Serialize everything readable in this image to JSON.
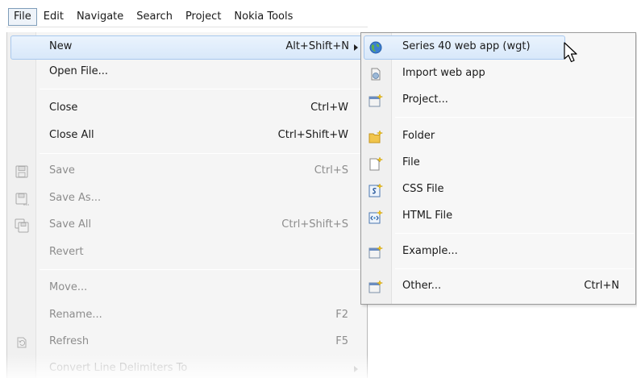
{
  "menubar": {
    "items": [
      "File",
      "Edit",
      "Navigate",
      "Search",
      "Project",
      "Nokia Tools"
    ]
  },
  "file_menu": {
    "new": {
      "label": "New",
      "shortcut": "Alt+Shift+N"
    },
    "open_file": {
      "label": "Open File..."
    },
    "close": {
      "label": "Close",
      "shortcut": "Ctrl+W"
    },
    "close_all": {
      "label": "Close All",
      "shortcut": "Ctrl+Shift+W"
    },
    "save": {
      "label": "Save",
      "shortcut": "Ctrl+S"
    },
    "save_as": {
      "label": "Save As..."
    },
    "save_all": {
      "label": "Save All",
      "shortcut": "Ctrl+Shift+S"
    },
    "revert": {
      "label": "Revert"
    },
    "move": {
      "label": "Move..."
    },
    "rename": {
      "label": "Rename...",
      "shortcut": "F2"
    },
    "refresh": {
      "label": "Refresh",
      "shortcut": "F5"
    },
    "convert": {
      "label": "Convert Line Delimiters To"
    }
  },
  "new_submenu": {
    "series40": {
      "label": "Series 40 web app (wgt)",
      "icon": "globe-icon"
    },
    "import": {
      "label": "Import web app",
      "icon": "import-icon"
    },
    "project": {
      "label": "Project...",
      "icon": "new-project-icon"
    },
    "folder": {
      "label": "Folder",
      "icon": "new-folder-icon"
    },
    "file": {
      "label": "File",
      "icon": "new-file-icon"
    },
    "css": {
      "label": "CSS File",
      "icon": "css-file-icon"
    },
    "html": {
      "label": "HTML File",
      "icon": "html-file-icon"
    },
    "example": {
      "label": "Example...",
      "icon": "new-example-icon"
    },
    "other": {
      "label": "Other...",
      "shortcut": "Ctrl+N",
      "icon": "new-other-icon"
    }
  },
  "colors": {
    "highlight_border": "#a8c8ee",
    "highlight_fill": "#d8e8fa",
    "disabled_text": "#8d8d8d"
  }
}
